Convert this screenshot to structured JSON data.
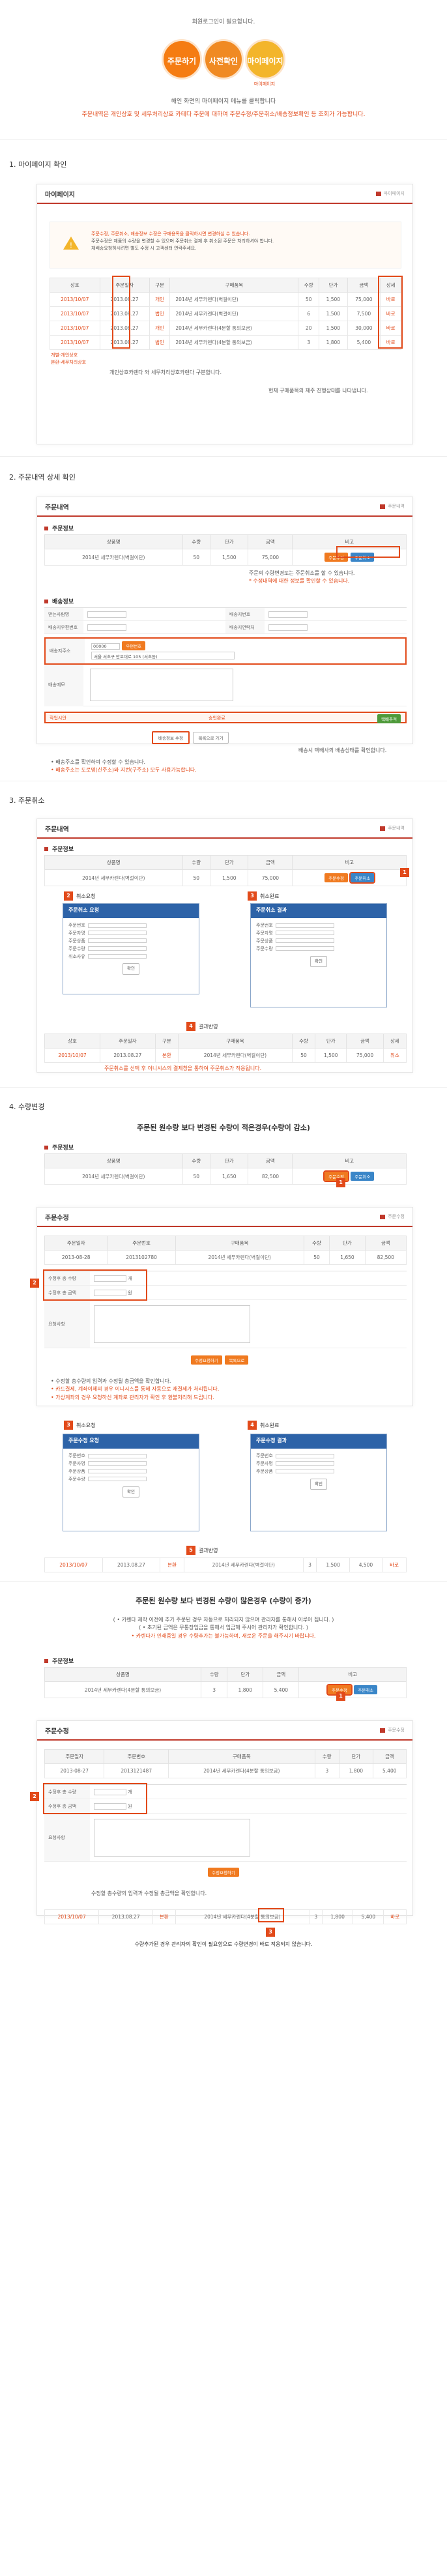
{
  "intro": {
    "need_login": "회원로그인이 필요합니다.",
    "circles": [
      "주문하기",
      "사전확인",
      "마이페이지"
    ],
    "circle_sub": "마이페이지",
    "desc1": "해인 화면의 마이페이지 메뉴를 클릭합니다",
    "desc2": "주문내역은 개인상호 및 세무처리상호 카테다 주문에 대하여 주문수정/주문취소/배송정보확인 등 조회가 가능합니다."
  },
  "sections": {
    "s1": "1. 마이페이지 확인",
    "s2": "2. 주문내역 상세 확인",
    "s3": "3. 주문취소",
    "s4": "4. 수량변경"
  },
  "mypage": {
    "title": "마이페이지",
    "crumb": "마이페이지",
    "notice_line1": "주문수정, 주문취소, 배송정보 수정은 구매용목을 클릭하시면 변경하실 수 있습니다.",
    "notice_line2": "주문수정은 제품의 수량을 변경할 수 있으며 주문취소 결제 후 취소된 주문은 처리하셔야 합니다.",
    "notice_line3": "재배송요청하시려면 별도 수정 시 고객센터 연락주세요.",
    "headers": [
      "상호",
      "주문일자",
      "구분",
      "구매품목",
      "수량",
      "단가",
      "금액",
      "상세"
    ],
    "rows": [
      [
        "2013/10/07",
        "2013.08.27",
        "개인",
        "2014년 세무카렌다(벽걸이단)",
        "50",
        "1,500",
        "75,000",
        "바로"
      ],
      [
        "2013/10/07",
        "2013.08.27",
        "법인",
        "2014년 세무카렌다(벽걸이단)",
        "6",
        "1,500",
        "7,500",
        "바로"
      ],
      [
        "2013/10/07",
        "2013.08.27",
        "개인",
        "2014년 세무카렌다(4분할 통의보금)",
        "20",
        "1,500",
        "30,000",
        "바로"
      ],
      [
        "2013/10/07",
        "2013.08.27",
        "법인",
        "2014년 세무카렌다(4분할 통의보금)",
        "3",
        "1,800",
        "5,400",
        "바로"
      ]
    ],
    "legend1": "개별-개인상호",
    "legend2": "본환-세무처리상호",
    "note1": "개인상호카렌다 와 세무처리상호카렌다 구분합니다.",
    "note2": "현재 구매품목의 재주 진행상태를 나타냅니다."
  },
  "detail": {
    "title": "주문내역",
    "crumb": "주문내역",
    "order_info": "주문정보",
    "headers": [
      "상품명",
      "수량",
      "단가",
      "금액",
      "비고"
    ],
    "row": [
      "2014년 세무카렌다(벽걸이단)",
      "50",
      "1,500",
      "75,000"
    ],
    "btn_modify": "주문수정",
    "btn_cancel": "주문취소",
    "note1": "주문의 수량변경또는 주문취소를 할 수 있습니다.",
    "note2": "* 수정내역에 대한 정보를 확인할 수 있습니다.",
    "delivery_info": "배송정보",
    "labels": [
      "받는사람명",
      "배송지우편번호",
      "배송지주소",
      "배송메모"
    ],
    "labels_right": [
      "배송지번호",
      "배송지연락처"
    ],
    "zip": "00000",
    "zip_btn": "우편번호",
    "address": "서울 서초구 반포대로 105 (서초동)",
    "status_label": "작업시안",
    "status_mid": "승인완료",
    "btn_status": "택배추적",
    "btn_edit": "배송정보 수정",
    "btn_list": "목록으로 가기",
    "note3": "배송시 택배사의 배송상태를 확인합니다.",
    "bullet1": "• 배송주소를 확인하여 수정할 수 있습니다.",
    "bullet2": "• 배송주소는 도로명(신주소)와 지번(구주소) 모두 사용가능합니다."
  },
  "cancel": {
    "title": "주문내역",
    "crumb": "주문내역",
    "order_info": "주문정보",
    "row": [
      "2014년 세무카렌다(벽걸이단)",
      "50",
      "1,500",
      "75,000"
    ],
    "cap1": "취소요청",
    "cap2": "취소완료",
    "cap3": "결과반영",
    "popup_title": "주문취소 요청",
    "popup_title2": "주문취소 결과",
    "popup_fields": [
      "주문번호",
      "주문자명",
      "주문상품",
      "주문수량",
      "취소사유"
    ],
    "popup_btn": "확인",
    "result_headers": [
      "상호",
      "주문일자",
      "구분",
      "구매품목",
      "수량",
      "단가",
      "금액",
      "상세"
    ],
    "result_row": [
      "2013/10/07",
      "2013.08.27",
      "본환",
      "2014년 세무카렌다(벽걸이단)",
      "50",
      "1,500",
      "75,000",
      "취소"
    ],
    "note": "주문취소를 선택 후 이니시스의 결제창을 통하여 주문취소가 적용됩니다."
  },
  "qty": {
    "heading1": "주문된 원수량 보다 변경된 수량이 적은경우(수량이 감소)",
    "heading2": "주문된 원수량 보다 변경된 수량이 많은경우 (수량이 증가)",
    "order_info": "주문정보",
    "headers": [
      "상품명",
      "수량",
      "단가",
      "금액",
      "비고"
    ],
    "row_a": [
      "2014년 세무카렌다(벽걸이단)",
      "50",
      "1,650",
      "82,500"
    ],
    "row_b": [
      "2014년 세무카렌다(4분할 통의보금)",
      "3",
      "1,800",
      "5,400"
    ],
    "modify_title": "주문수정",
    "modify_headers": [
      "주문일자",
      "주문번호",
      "구매품목",
      "수량",
      "단가",
      "금액"
    ],
    "modify_row_a": [
      "2013-08-28",
      "2013102780",
      "2014년 세무카렌다(벽걸이단)",
      "50",
      "1,650",
      "82,500"
    ],
    "modify_row_b": [
      "2013-08-27",
      "2013121487",
      "2014년 세무카렌다(4분할 통의보금)",
      "3",
      "1,800",
      "5,400"
    ],
    "form_labels": [
      "수정후 총 수량",
      "수정후 총 금액",
      "요청사항"
    ],
    "unit": "개",
    "won": "원",
    "btn_submit": "수정요청하기",
    "btn_back": "목록으로",
    "bullets": [
      "• 수정할 총수량의 입력과 수정될 총금액을 확인합니다.",
      "• 카드결제, 계좌이체의 경우 이니시스를 통해 자동으로 재결제가 처리됩니다.",
      "• 가상계좌의 경우 요청하신 계좌로 관리자가 확인 후 환불처리해 드립니다."
    ],
    "cap1": "취소요청",
    "cap2": "취소완료",
    "cap3": "결과반영",
    "popup_title": "주문수정 요청",
    "popup_title2": "주문수정 결과",
    "result_row_a": [
      "2013/10/07",
      "2013.08.27",
      "본환",
      "2014년 세무카렌다(벽걸이단)",
      "3",
      "1,500",
      "4,500",
      "바로"
    ],
    "plus_notes": [
      "( • 카렌다 제작 이전에 추가 주문된 경우 자동으로 처리되지 않으며 관리자를 통해서 이루어 집니다. )",
      "( • 초기된 금액은 무통장입금을 통해서 입금해 주시어 관리자가 확인합니다. )",
      "• 카렌다가 인쇄중일 경우 수량추가는 불가능하며, 새로운 주문을 해주시기 바랍니다."
    ],
    "note_plus": "수정할 총수량의 입력과 수정될 총금액을 확인합니다.",
    "result_row_b": [
      "2013/10/07",
      "2013.08.27",
      "본환",
      "2014년 세무카렌다(4분할 통의보금)",
      "3",
      "1,800",
      "5,400",
      "바로"
    ],
    "final_note": "수량추가된 경우 관리자의 확인이 필요함으로 수량변경이 바로 적용되지 않습니다."
  }
}
